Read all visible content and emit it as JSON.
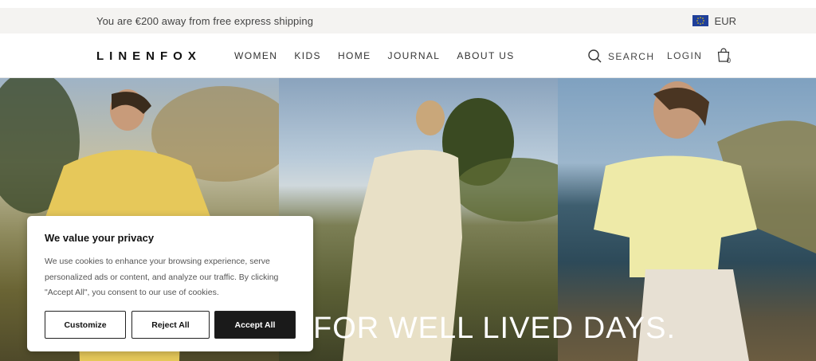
{
  "topbar": {
    "promo": "You are €200 away from free express shipping",
    "currency": "EUR"
  },
  "header": {
    "logo": "LINENFOX",
    "nav": [
      "WOMEN",
      "KIDS",
      "HOME",
      "JOURNAL",
      "ABOUT US"
    ],
    "search_label": "SEARCH",
    "login_label": "LOGIN",
    "cart_count": "0"
  },
  "hero": {
    "title": "FOR WELL LIVED DAYS."
  },
  "cookie_banner": {
    "title": "We value your privacy",
    "text": "We use cookies to enhance your browsing experience, serve personalized ads or content, and analyze our traffic. By clicking \"Accept All\", you consent to our use of cookies.",
    "customize_label": "Customize",
    "reject_label": "Reject All",
    "accept_label": "Accept All"
  },
  "colors": {
    "topbar_bg": "#f4f3f1",
    "accept_bg": "#1a1a1a"
  }
}
